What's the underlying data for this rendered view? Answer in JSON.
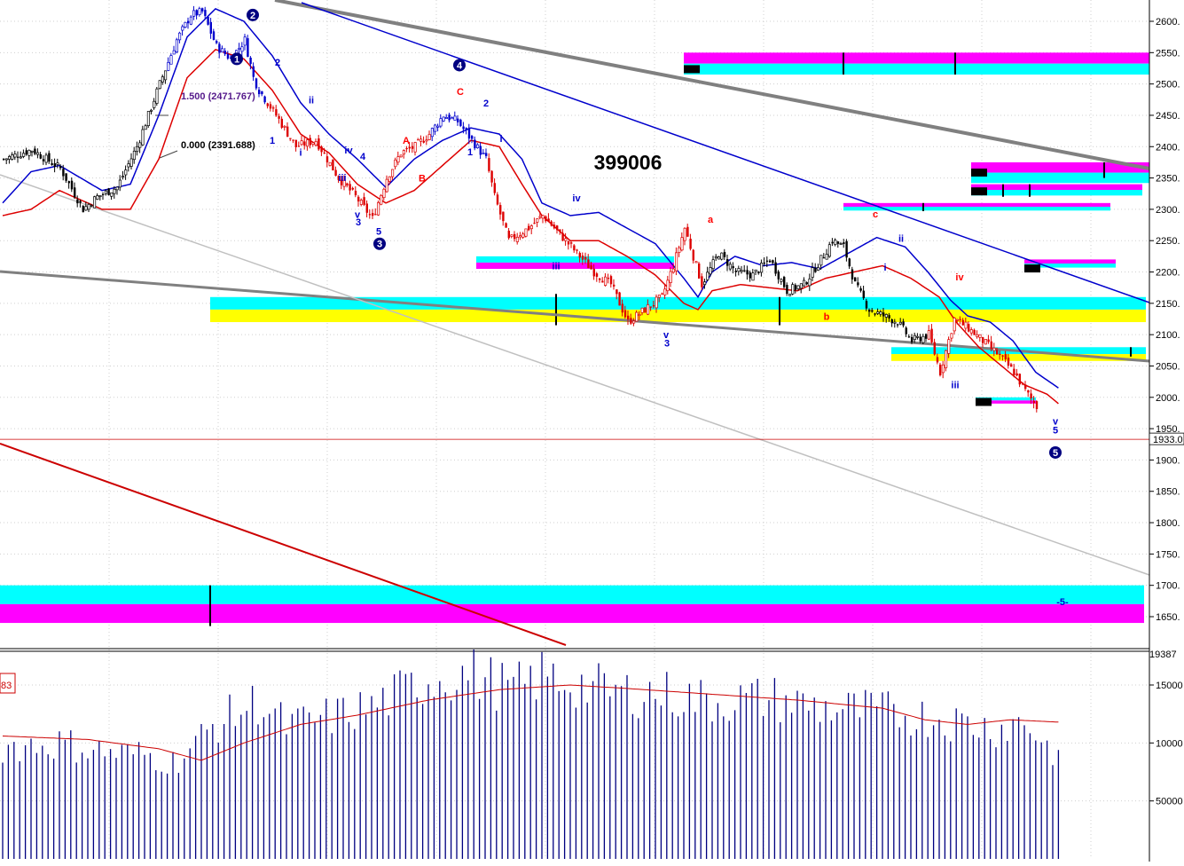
{
  "chart_data": [
    {
      "type": "candlestick",
      "title": "399006",
      "y_axis_side": "right",
      "ylim": [
        1620,
        2635
      ],
      "grid": true,
      "ticks": [
        2600,
        2550,
        2500,
        2450,
        2400,
        2350,
        2300,
        2250,
        2200,
        2150,
        2100,
        2050,
        2000,
        1950,
        1900,
        1850,
        1800,
        1750,
        1700,
        1650
      ],
      "tick_labels": [
        "2600.",
        "2550.",
        "2500.",
        "2450.",
        "2400.",
        "2350.",
        "2300.",
        "2250.",
        "2200.",
        "2150.",
        "2100.",
        "2050.",
        "2000.",
        "1950.",
        "1900.",
        "1850.",
        "1800.",
        "1750.",
        "1700.",
        "1650."
      ],
      "current_price": 1933,
      "current_price_label": "1933.0",
      "fib_annotations": [
        {
          "text": "1.500 (2471.767)",
          "value": 2471.767
        },
        {
          "text": "0.000 (2391.688)",
          "value": 2391.688
        }
      ],
      "close_waypoints": [
        [
          0,
          2380
        ],
        [
          10,
          2395
        ],
        [
          20,
          2365
        ],
        [
          28,
          2300
        ],
        [
          33,
          2320
        ],
        [
          40,
          2335
        ],
        [
          47,
          2400
        ],
        [
          55,
          2500
        ],
        [
          61,
          2570
        ],
        [
          66,
          2610
        ],
        [
          70,
          2615
        ],
        [
          75,
          2560
        ],
        [
          80,
          2540
        ],
        [
          85,
          2570
        ],
        [
          88,
          2510
        ],
        [
          90,
          2490
        ],
        [
          96,
          2450
        ],
        [
          103,
          2400
        ],
        [
          110,
          2410
        ],
        [
          118,
          2350
        ],
        [
          124,
          2320
        ],
        [
          130,
          2285
        ],
        [
          135,
          2350
        ],
        [
          140,
          2390
        ],
        [
          145,
          2400
        ],
        [
          150,
          2420
        ],
        [
          155,
          2450
        ],
        [
          160,
          2440
        ],
        [
          165,
          2410
        ],
        [
          170,
          2380
        ],
        [
          173,
          2320
        ],
        [
          178,
          2250
        ],
        [
          185,
          2270
        ],
        [
          190,
          2290
        ],
        [
          196,
          2260
        ],
        [
          202,
          2230
        ],
        [
          208,
          2200
        ],
        [
          214,
          2180
        ],
        [
          220,
          2120
        ],
        [
          226,
          2140
        ],
        [
          232,
          2160
        ],
        [
          236,
          2210
        ],
        [
          240,
          2270
        ],
        [
          246,
          2180
        ],
        [
          252,
          2230
        ],
        [
          258,
          2200
        ],
        [
          264,
          2195
        ],
        [
          270,
          2220
        ],
        [
          276,
          2170
        ],
        [
          282,
          2180
        ],
        [
          288,
          2220
        ],
        [
          292,
          2250
        ],
        [
          296,
          2240
        ],
        [
          300,
          2180
        ],
        [
          305,
          2140
        ],
        [
          310,
          2130
        ],
        [
          315,
          2120
        ],
        [
          320,
          2090
        ],
        [
          326,
          2100
        ],
        [
          330,
          2040
        ],
        [
          335,
          2125
        ],
        [
          340,
          2110
        ],
        [
          345,
          2090
        ],
        [
          350,
          2070
        ],
        [
          356,
          2040
        ],
        [
          360,
          2010
        ],
        [
          364,
          1985
        ]
      ],
      "ma_blue_waypoints": [
        [
          0,
          2310
        ],
        [
          10,
          2360
        ],
        [
          20,
          2370
        ],
        [
          35,
          2330
        ],
        [
          45,
          2340
        ],
        [
          55,
          2450
        ],
        [
          65,
          2575
        ],
        [
          75,
          2620
        ],
        [
          85,
          2600
        ],
        [
          95,
          2545
        ],
        [
          105,
          2470
        ],
        [
          115,
          2420
        ],
        [
          125,
          2380
        ],
        [
          135,
          2335
        ],
        [
          145,
          2380
        ],
        [
          155,
          2410
        ],
        [
          165,
          2430
        ],
        [
          175,
          2420
        ],
        [
          183,
          2380
        ],
        [
          190,
          2310
        ],
        [
          200,
          2290
        ],
        [
          210,
          2295
        ],
        [
          220,
          2270
        ],
        [
          230,
          2245
        ],
        [
          240,
          2190
        ],
        [
          245,
          2160
        ],
        [
          250,
          2200
        ],
        [
          258,
          2225
        ],
        [
          268,
          2210
        ],
        [
          278,
          2215
        ],
        [
          288,
          2205
        ],
        [
          298,
          2230
        ],
        [
          308,
          2255
        ],
        [
          318,
          2240
        ],
        [
          326,
          2200
        ],
        [
          334,
          2155
        ],
        [
          340,
          2130
        ],
        [
          348,
          2120
        ],
        [
          356,
          2090
        ],
        [
          364,
          2040
        ],
        [
          372,
          2015
        ]
      ],
      "ma_red_waypoints": [
        [
          0,
          2290
        ],
        [
          10,
          2300
        ],
        [
          20,
          2330
        ],
        [
          35,
          2300
        ],
        [
          45,
          2300
        ],
        [
          55,
          2380
        ],
        [
          65,
          2510
        ],
        [
          75,
          2555
        ],
        [
          85,
          2540
        ],
        [
          95,
          2490
        ],
        [
          105,
          2420
        ],
        [
          115,
          2390
        ],
        [
          125,
          2340
        ],
        [
          135,
          2310
        ],
        [
          145,
          2330
        ],
        [
          155,
          2370
        ],
        [
          165,
          2410
        ],
        [
          175,
          2400
        ],
        [
          183,
          2340
        ],
        [
          190,
          2290
        ],
        [
          200,
          2250
        ],
        [
          210,
          2250
        ],
        [
          220,
          2225
        ],
        [
          230,
          2195
        ],
        [
          240,
          2150
        ],
        [
          245,
          2140
        ],
        [
          250,
          2170
        ],
        [
          260,
          2180
        ],
        [
          270,
          2175
        ],
        [
          280,
          2170
        ],
        [
          290,
          2190
        ],
        [
          300,
          2200
        ],
        [
          310,
          2210
        ],
        [
          320,
          2190
        ],
        [
          330,
          2160
        ],
        [
          336,
          2120
        ],
        [
          344,
          2080
        ],
        [
          352,
          2050
        ],
        [
          360,
          2020
        ],
        [
          368,
          2005
        ],
        [
          372,
          1990
        ]
      ],
      "zones": [
        {
          "x_from": 237,
          "x_to": 1292,
          "colors": [
            "#00ffff",
            "#ffff00"
          ],
          "top": 2160,
          "bottom": 2120
        },
        {
          "x_from": 0,
          "x_to": 1290,
          "colors": [
            "#00ffff",
            "#ff00ff"
          ],
          "top": 1700,
          "bottom": 1640
        },
        {
          "x_from": 771,
          "x_to": 1296,
          "colors": [
            "#ff00ff",
            "#00ffff"
          ],
          "top": 2550,
          "bottom": 2515
        },
        {
          "x_from": 537,
          "x_to": 760,
          "colors": [
            "#00ffff",
            "#ff00ff"
          ],
          "top": 2225,
          "bottom": 2205
        },
        {
          "x_from": 951,
          "x_to": 1252,
          "colors": [
            "#ff00ff",
            "#00ffff"
          ],
          "top": 2310,
          "bottom": 2298
        },
        {
          "x_from": 1095,
          "x_to": 1296,
          "colors": [
            "#ff00ff",
            "#00ffff"
          ],
          "top": 2375,
          "bottom": 2342
        },
        {
          "x_from": 1095,
          "x_to": 1288,
          "colors": [
            "#ff00ff",
            "#00ffff"
          ],
          "top": 2340,
          "bottom": 2322
        },
        {
          "x_from": 1155,
          "x_to": 1258,
          "colors": [
            "#ff00ff",
            "#00ffff"
          ],
          "top": 2220,
          "bottom": 2207
        },
        {
          "x_from": 1005,
          "x_to": 1292,
          "colors": [
            "#00ffff",
            "#ffff00"
          ],
          "top": 2080,
          "bottom": 2058
        },
        {
          "x_from": 1100,
          "x_to": 1168,
          "colors": [
            "#00ffff",
            "#ff00ff"
          ],
          "top": 2000,
          "bottom": 1990
        }
      ],
      "wave_labels": [
        {
          "text": "1",
          "circled": true,
          "color": "#000080",
          "x": 267,
          "y": 2540
        },
        {
          "text": "2",
          "circled": true,
          "color": "#000080",
          "x": 285,
          "y": 2610
        },
        {
          "text": "3",
          "circled": true,
          "color": "#000080",
          "x": 428,
          "y": 2245
        },
        {
          "text": "4",
          "circled": true,
          "color": "#000080",
          "x": 518,
          "y": 2530
        },
        {
          "text": "5",
          "circled": true,
          "color": "#000080",
          "x": 1190,
          "y": 1912
        },
        {
          "text": "2",
          "color": "#0000cc",
          "x": 313,
          "y": 2535
        },
        {
          "text": "1",
          "color": "#0000cc",
          "x": 307,
          "y": 2410
        },
        {
          "text": "ii",
          "color": "#0000cc",
          "x": 351,
          "y": 2475
        },
        {
          "text": "i",
          "color": "#0000cc",
          "x": 339,
          "y": 2391
        },
        {
          "text": "iv",
          "color": "#0000cc",
          "x": 393,
          "y": 2395
        },
        {
          "text": "4",
          "color": "#0000cc",
          "x": 409,
          "y": 2385
        },
        {
          "text": "iii",
          "color": "#0000cc",
          "x": 386,
          "y": 2351
        },
        {
          "text": "v",
          "color": "#0000cc",
          "x": 403,
          "y": 2292
        },
        {
          "text": "3",
          "color": "#0000cc",
          "x": 404,
          "y": 2280
        },
        {
          "text": "5",
          "color": "#0000cc",
          "x": 427,
          "y": 2265
        },
        {
          "text": "A",
          "color": "#ff0000",
          "x": 458,
          "y": 2410
        },
        {
          "text": "B",
          "color": "#ff0000",
          "x": 476,
          "y": 2350
        },
        {
          "text": "C",
          "color": "#ff0000",
          "x": 519,
          "y": 2488
        },
        {
          "text": "2",
          "color": "#0000cc",
          "x": 548,
          "y": 2470
        },
        {
          "text": "i",
          "color": "#0000cc",
          "x": 565,
          "y": 2413
        },
        {
          "text": "1",
          "color": "#0000cc",
          "x": 530,
          "y": 2392
        },
        {
          "text": "iv",
          "color": "#0000cc",
          "x": 650,
          "y": 2318
        },
        {
          "text": "iii",
          "color": "#0000cc",
          "x": 627,
          "y": 2210
        },
        {
          "text": "v",
          "color": "#0000cc",
          "x": 751,
          "y": 2100
        },
        {
          "text": "3",
          "color": "#0000cc",
          "x": 752,
          "y": 2087
        },
        {
          "text": "a",
          "color": "#ff0000",
          "x": 801,
          "y": 2284
        },
        {
          "text": "b",
          "color": "#ff0000",
          "x": 932,
          "y": 2129
        },
        {
          "text": "c",
          "color": "#ff0000",
          "x": 987,
          "y": 2293
        },
        {
          "text": "ii",
          "color": "#0000cc",
          "x": 1016,
          "y": 2254
        },
        {
          "text": "i",
          "color": "#0000cc",
          "x": 998,
          "y": 2208
        },
        {
          "text": "iv",
          "color": "#ff0000",
          "x": 1082,
          "y": 2192
        },
        {
          "text": "iii",
          "color": "#0000cc",
          "x": 1077,
          "y": 2020
        },
        {
          "text": "v",
          "color": "#0000cc",
          "x": 1190,
          "y": 1962
        },
        {
          "text": "5",
          "color": "#0000cc",
          "x": 1190,
          "y": 1948
        },
        {
          "text": "-5-",
          "color": "#0000cc",
          "x": 1198,
          "y": 1674
        }
      ]
    },
    {
      "type": "bar",
      "panel": "volume",
      "ylim": [
        0,
        175000
      ],
      "tick_values": [
        150000,
        100000,
        50000
      ],
      "tick_labels": [
        "15000",
        "10000",
        "50000"
      ],
      "top_label": "19387",
      "left_label": "83",
      "volume_waypoints": [
        [
          0,
          100000
        ],
        [
          20,
          103000
        ],
        [
          40,
          94000
        ],
        [
          50,
          93000
        ],
        [
          60,
          86000
        ],
        [
          65,
          95000
        ],
        [
          75,
          120000
        ],
        [
          90,
          140000
        ],
        [
          100,
          118000
        ],
        [
          110,
          123000
        ],
        [
          130,
          135000
        ],
        [
          150,
          160000
        ],
        [
          165,
          165000
        ],
        [
          180,
          150000
        ],
        [
          190,
          163000
        ],
        [
          200,
          157000
        ],
        [
          215,
          148000
        ],
        [
          230,
          148000
        ],
        [
          250,
          140000
        ],
        [
          270,
          143000
        ],
        [
          290,
          134000
        ],
        [
          310,
          131000
        ],
        [
          330,
          125000
        ],
        [
          350,
          116000
        ],
        [
          360,
          123000
        ],
        [
          368,
          100000
        ],
        [
          372,
          92000
        ]
      ],
      "ma_waypoints": [
        [
          0,
          106000
        ],
        [
          30,
          103000
        ],
        [
          55,
          95000
        ],
        [
          70,
          85000
        ],
        [
          85,
          100000
        ],
        [
          105,
          116000
        ],
        [
          125,
          124000
        ],
        [
          150,
          137000
        ],
        [
          175,
          146000
        ],
        [
          200,
          150000
        ],
        [
          220,
          147000
        ],
        [
          250,
          142000
        ],
        [
          280,
          137000
        ],
        [
          310,
          130000
        ],
        [
          325,
          120000
        ],
        [
          340,
          116000
        ],
        [
          355,
          120000
        ],
        [
          372,
          118000
        ]
      ]
    }
  ]
}
